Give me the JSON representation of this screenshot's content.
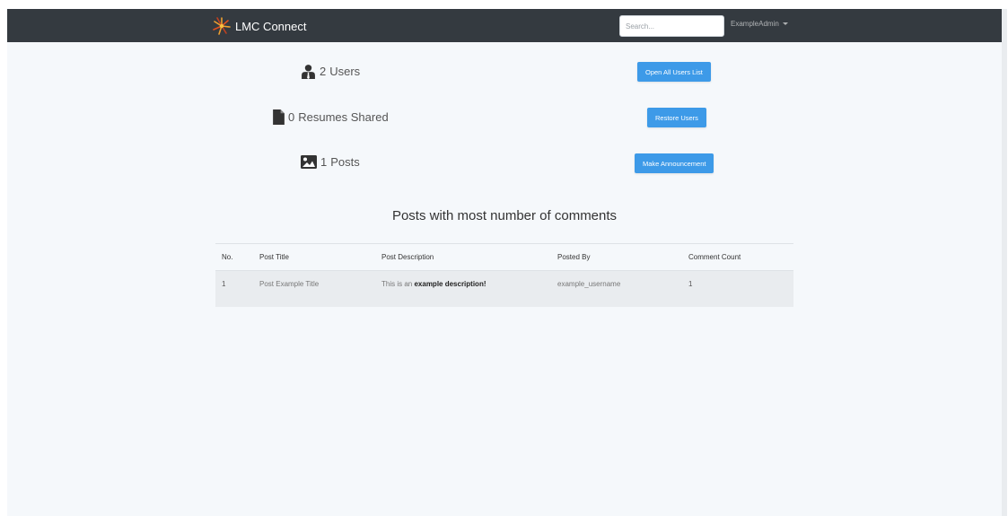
{
  "navbar": {
    "brand": "LMC Connect",
    "search_placeholder": "Search...",
    "user_menu": "ExampleAdmin"
  },
  "stats": [
    {
      "icon": "users-icon",
      "count": "2",
      "label": "Users"
    },
    {
      "icon": "document-icon",
      "count": "0",
      "label": "Resumes Shared"
    },
    {
      "icon": "image-icon",
      "count": "1",
      "label": "Posts"
    }
  ],
  "actions": {
    "open_users": "Open All Users List",
    "restore_users": "Restore Users",
    "announcement": "Make Announcement"
  },
  "section_title": "Posts with most number of comments",
  "table": {
    "headers": [
      "No.",
      "Post Title",
      "Post Description",
      "Posted By",
      "Comment Count"
    ],
    "rows": [
      {
        "no": "1",
        "title": "Post Example Title",
        "description_prefix": "This is an ",
        "description_bold": "example description!",
        "posted_by": "example_username",
        "comment_count": "1"
      }
    ]
  },
  "colors": {
    "navbar": "#343a40",
    "button": "#3d9ae8",
    "background": "#f5f8fb"
  }
}
